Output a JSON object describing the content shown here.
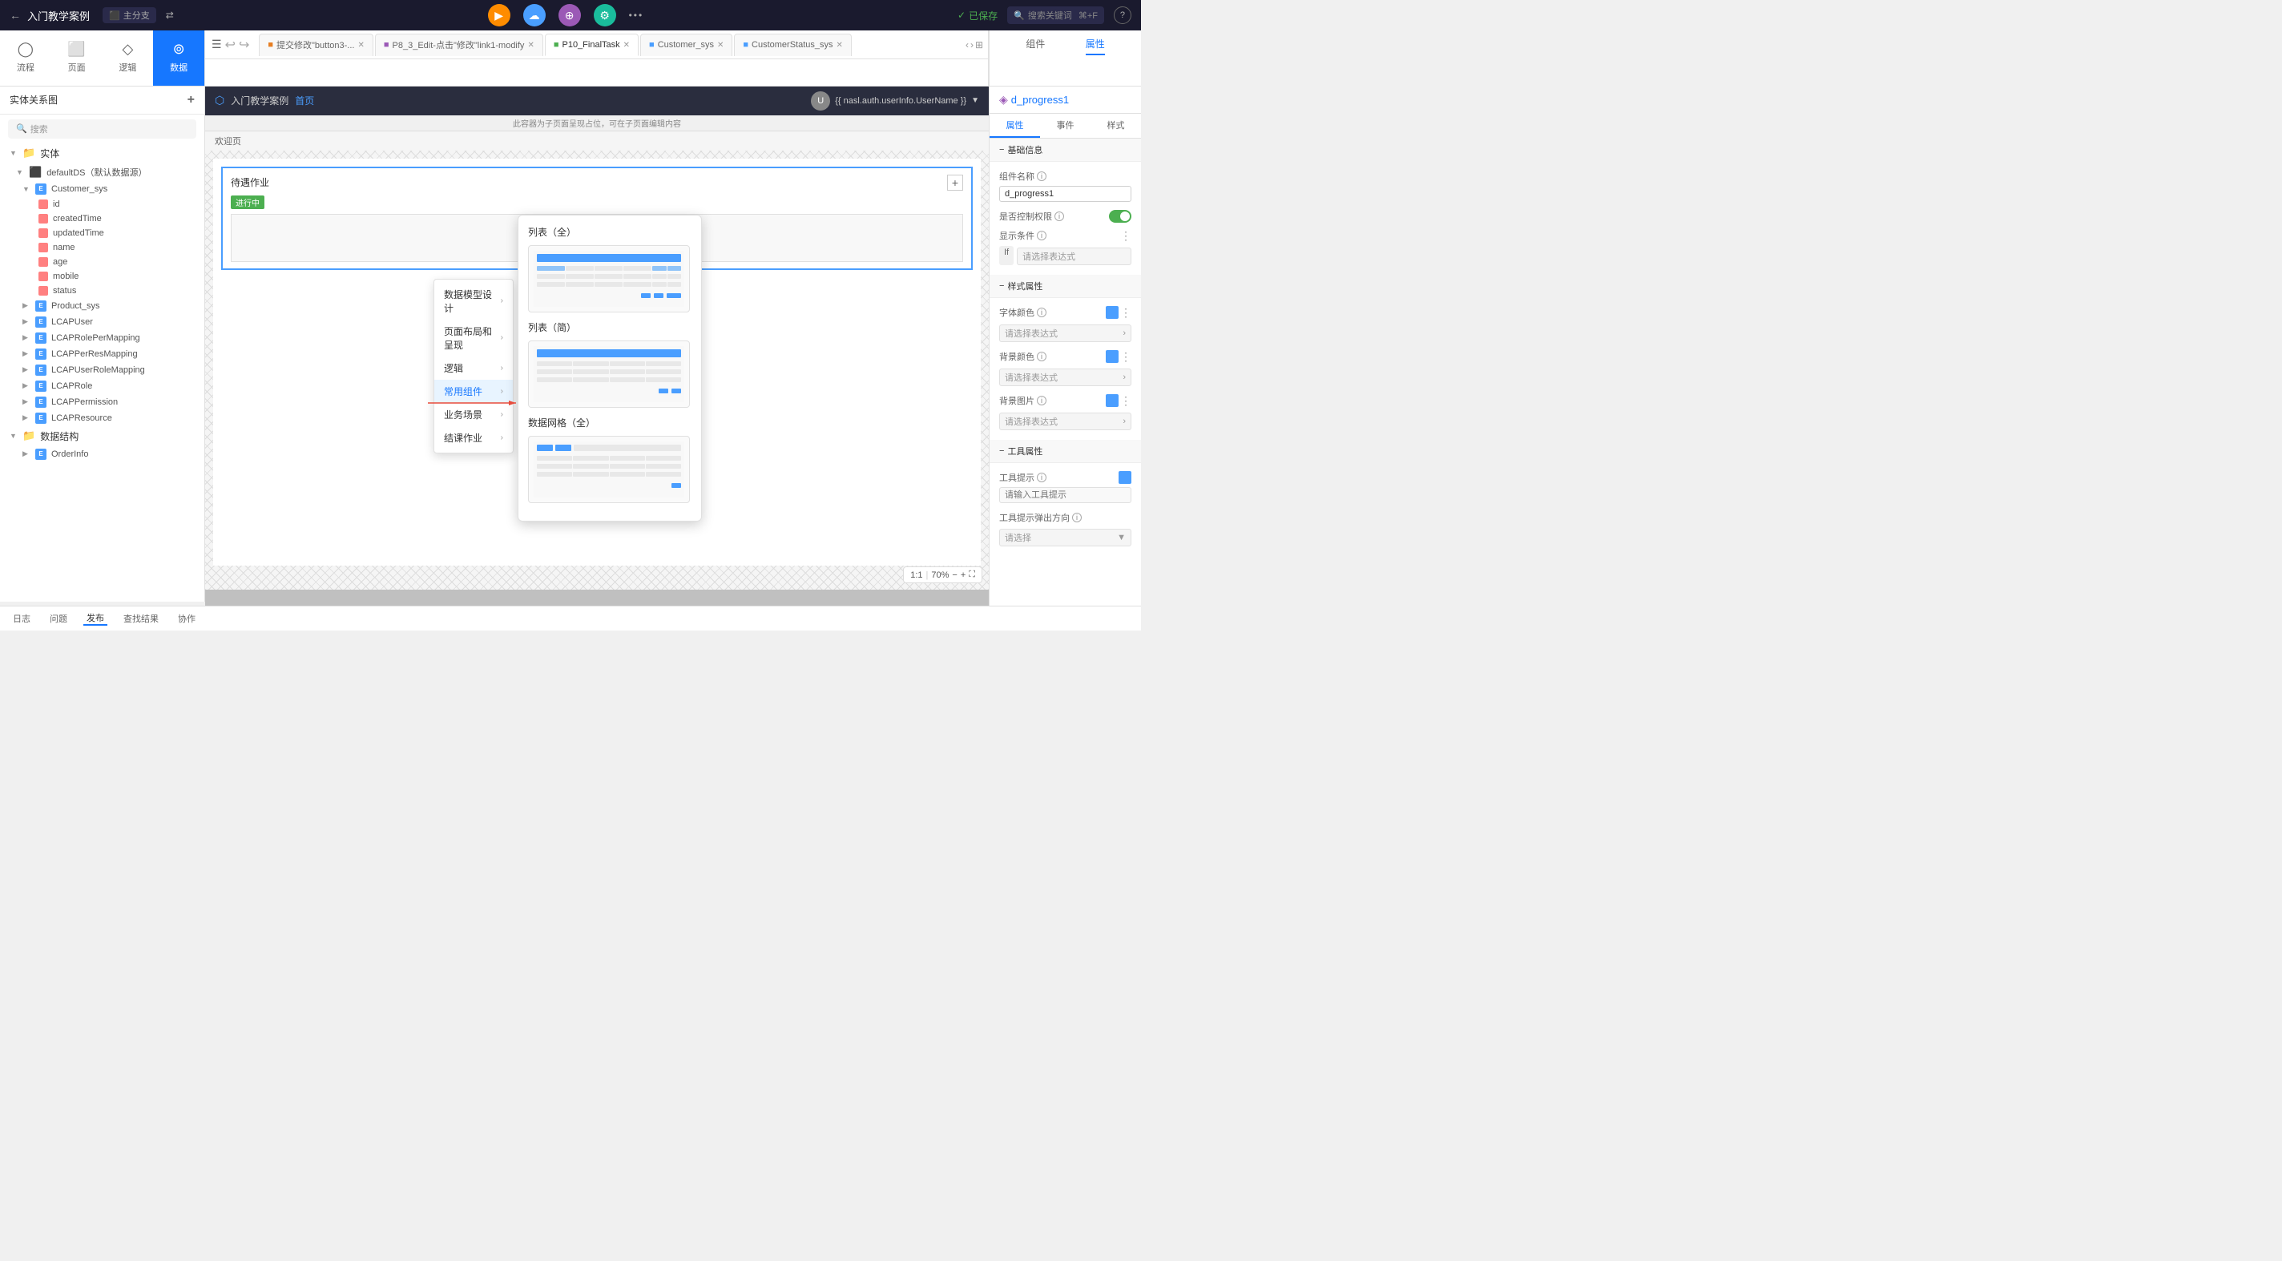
{
  "app": {
    "title": "入门教学案例",
    "branch": "主分支",
    "saved_status": "已保存"
  },
  "top_bar": {
    "back_icon": "←",
    "sync_icon": "⇄",
    "play_icon": "▶",
    "cloud_icon": "☁",
    "globe_icon": "⊕",
    "settings_icon": "⊙",
    "more_icon": "•••",
    "search_placeholder": "搜索关键词",
    "search_shortcut": "⌘+F",
    "help_icon": "?"
  },
  "tabs": [
    {
      "id": "tab1",
      "label": "提交修改\"button3-...",
      "type": "default",
      "closable": true
    },
    {
      "id": "tab2",
      "label": "P8_3_Edit-点击\"修改\"link1-modify",
      "type": "default",
      "closable": true
    },
    {
      "id": "tab3",
      "label": "P10_FinalTask",
      "type": "active",
      "closable": true
    },
    {
      "id": "tab4",
      "label": "Customer_sys",
      "type": "default",
      "closable": true
    },
    {
      "id": "tab5",
      "label": "CustomerStatus_sys",
      "type": "default",
      "closable": true
    }
  ],
  "nav_icons": [
    {
      "id": "process",
      "label": "流程",
      "icon": "◯"
    },
    {
      "id": "page",
      "label": "页面",
      "icon": "⬜"
    },
    {
      "id": "logic",
      "label": "逻辑",
      "icon": "◇"
    },
    {
      "id": "data",
      "label": "数据",
      "icon": "⊚",
      "active": true
    }
  ],
  "sidebar": {
    "header": "实体关系图",
    "search_placeholder": "搜索",
    "tree": {
      "entities_label": "实体",
      "defaultDS_label": "defaultDS（默认数据源）",
      "customer_sys": {
        "label": "Customer_sys",
        "fields": [
          "id",
          "createdTime",
          "updatedTime",
          "name",
          "age",
          "mobile",
          "status"
        ]
      },
      "product_sys": {
        "label": "Product_sys"
      },
      "lcap_user": {
        "label": "LCAPUser"
      },
      "lcap_role_per": {
        "label": "LCAPRolePerMapping"
      },
      "lcap_per_res": {
        "label": "LCAPPerResMapping"
      },
      "lcap_user_role": {
        "label": "LCAPUserRoleMapping"
      },
      "lcap_role": {
        "label": "LCAPRole"
      },
      "lcap_permission": {
        "label": "LCAPPermission"
      },
      "lcap_resource": {
        "label": "LCAPResource"
      },
      "data_structure_label": "数据结构",
      "order_info": {
        "label": "OrderInfo"
      }
    }
  },
  "canvas": {
    "welcome_label": "欢迎页",
    "header_label": "入门教学案例",
    "home_label": "首页",
    "user_var": "{{ nasl.auth.userInfo.UserName }}",
    "notice": "此容器为子页面呈现占位，可在子页面编辑内容",
    "progress_title": "待遇作业",
    "progress_status": "进行中",
    "zoom_ratio": "1:1",
    "zoom_level": "70%"
  },
  "dropdown_menu": {
    "items": [
      {
        "label": "数据模型设计",
        "has_sub": true
      },
      {
        "label": "页面布局和呈现",
        "has_sub": true
      },
      {
        "label": "逻辑",
        "has_sub": true
      },
      {
        "label": "常用组件",
        "has_sub": true,
        "active": true
      },
      {
        "label": "业务场景",
        "has_sub": true
      },
      {
        "label": "结课作业",
        "has_sub": true
      }
    ]
  },
  "component_panel": {
    "section1_label": "列表（全）",
    "section2_label": "列表（简）",
    "section3_label": "数据网格（全）"
  },
  "right_panel": {
    "component_name": "d_progress1",
    "tabs": [
      "属性",
      "事件",
      "样式"
    ],
    "active_tab": "属性",
    "sections": {
      "basic_info": "基础信息",
      "style_props": "样式属性",
      "tool_props": "工具属性"
    },
    "fields": {
      "component_name_label": "组件名称",
      "component_name_value": "d_progress1",
      "control_permission_label": "是否控制权限",
      "control_permission_info": "ⓘ",
      "display_condition_label": "显示条件",
      "display_condition_info": "ⓘ",
      "display_condition_if": "If",
      "display_condition_placeholder": "请选择表达式",
      "font_color_label": "字体颜色",
      "font_color_info": "ⓘ",
      "font_color_placeholder": "请选择表达式",
      "bg_color_label": "背景颜色",
      "bg_color_info": "ⓘ",
      "bg_color_placeholder": "请选择表达式",
      "bg_image_label": "背景图片",
      "bg_image_info": "ⓘ",
      "bg_image_placeholder": "请选择表达式",
      "tool_tip_label": "工具提示",
      "tool_tip_info": "ⓘ",
      "tool_tip_placeholder": "请输入工具提示",
      "tool_tip_direction_label": "工具提示弹出方向",
      "tool_tip_direction_info": "ⓘ",
      "tool_tip_direction_value": "请选择"
    }
  },
  "right_nav": {
    "tabs": [
      "组件",
      "属性"
    ],
    "active_tab": "属性"
  },
  "bottom_bar": {
    "tabs": [
      "日志",
      "问题",
      "发布",
      "查找结果",
      "协作"
    ],
    "active_tab": "发布"
  }
}
